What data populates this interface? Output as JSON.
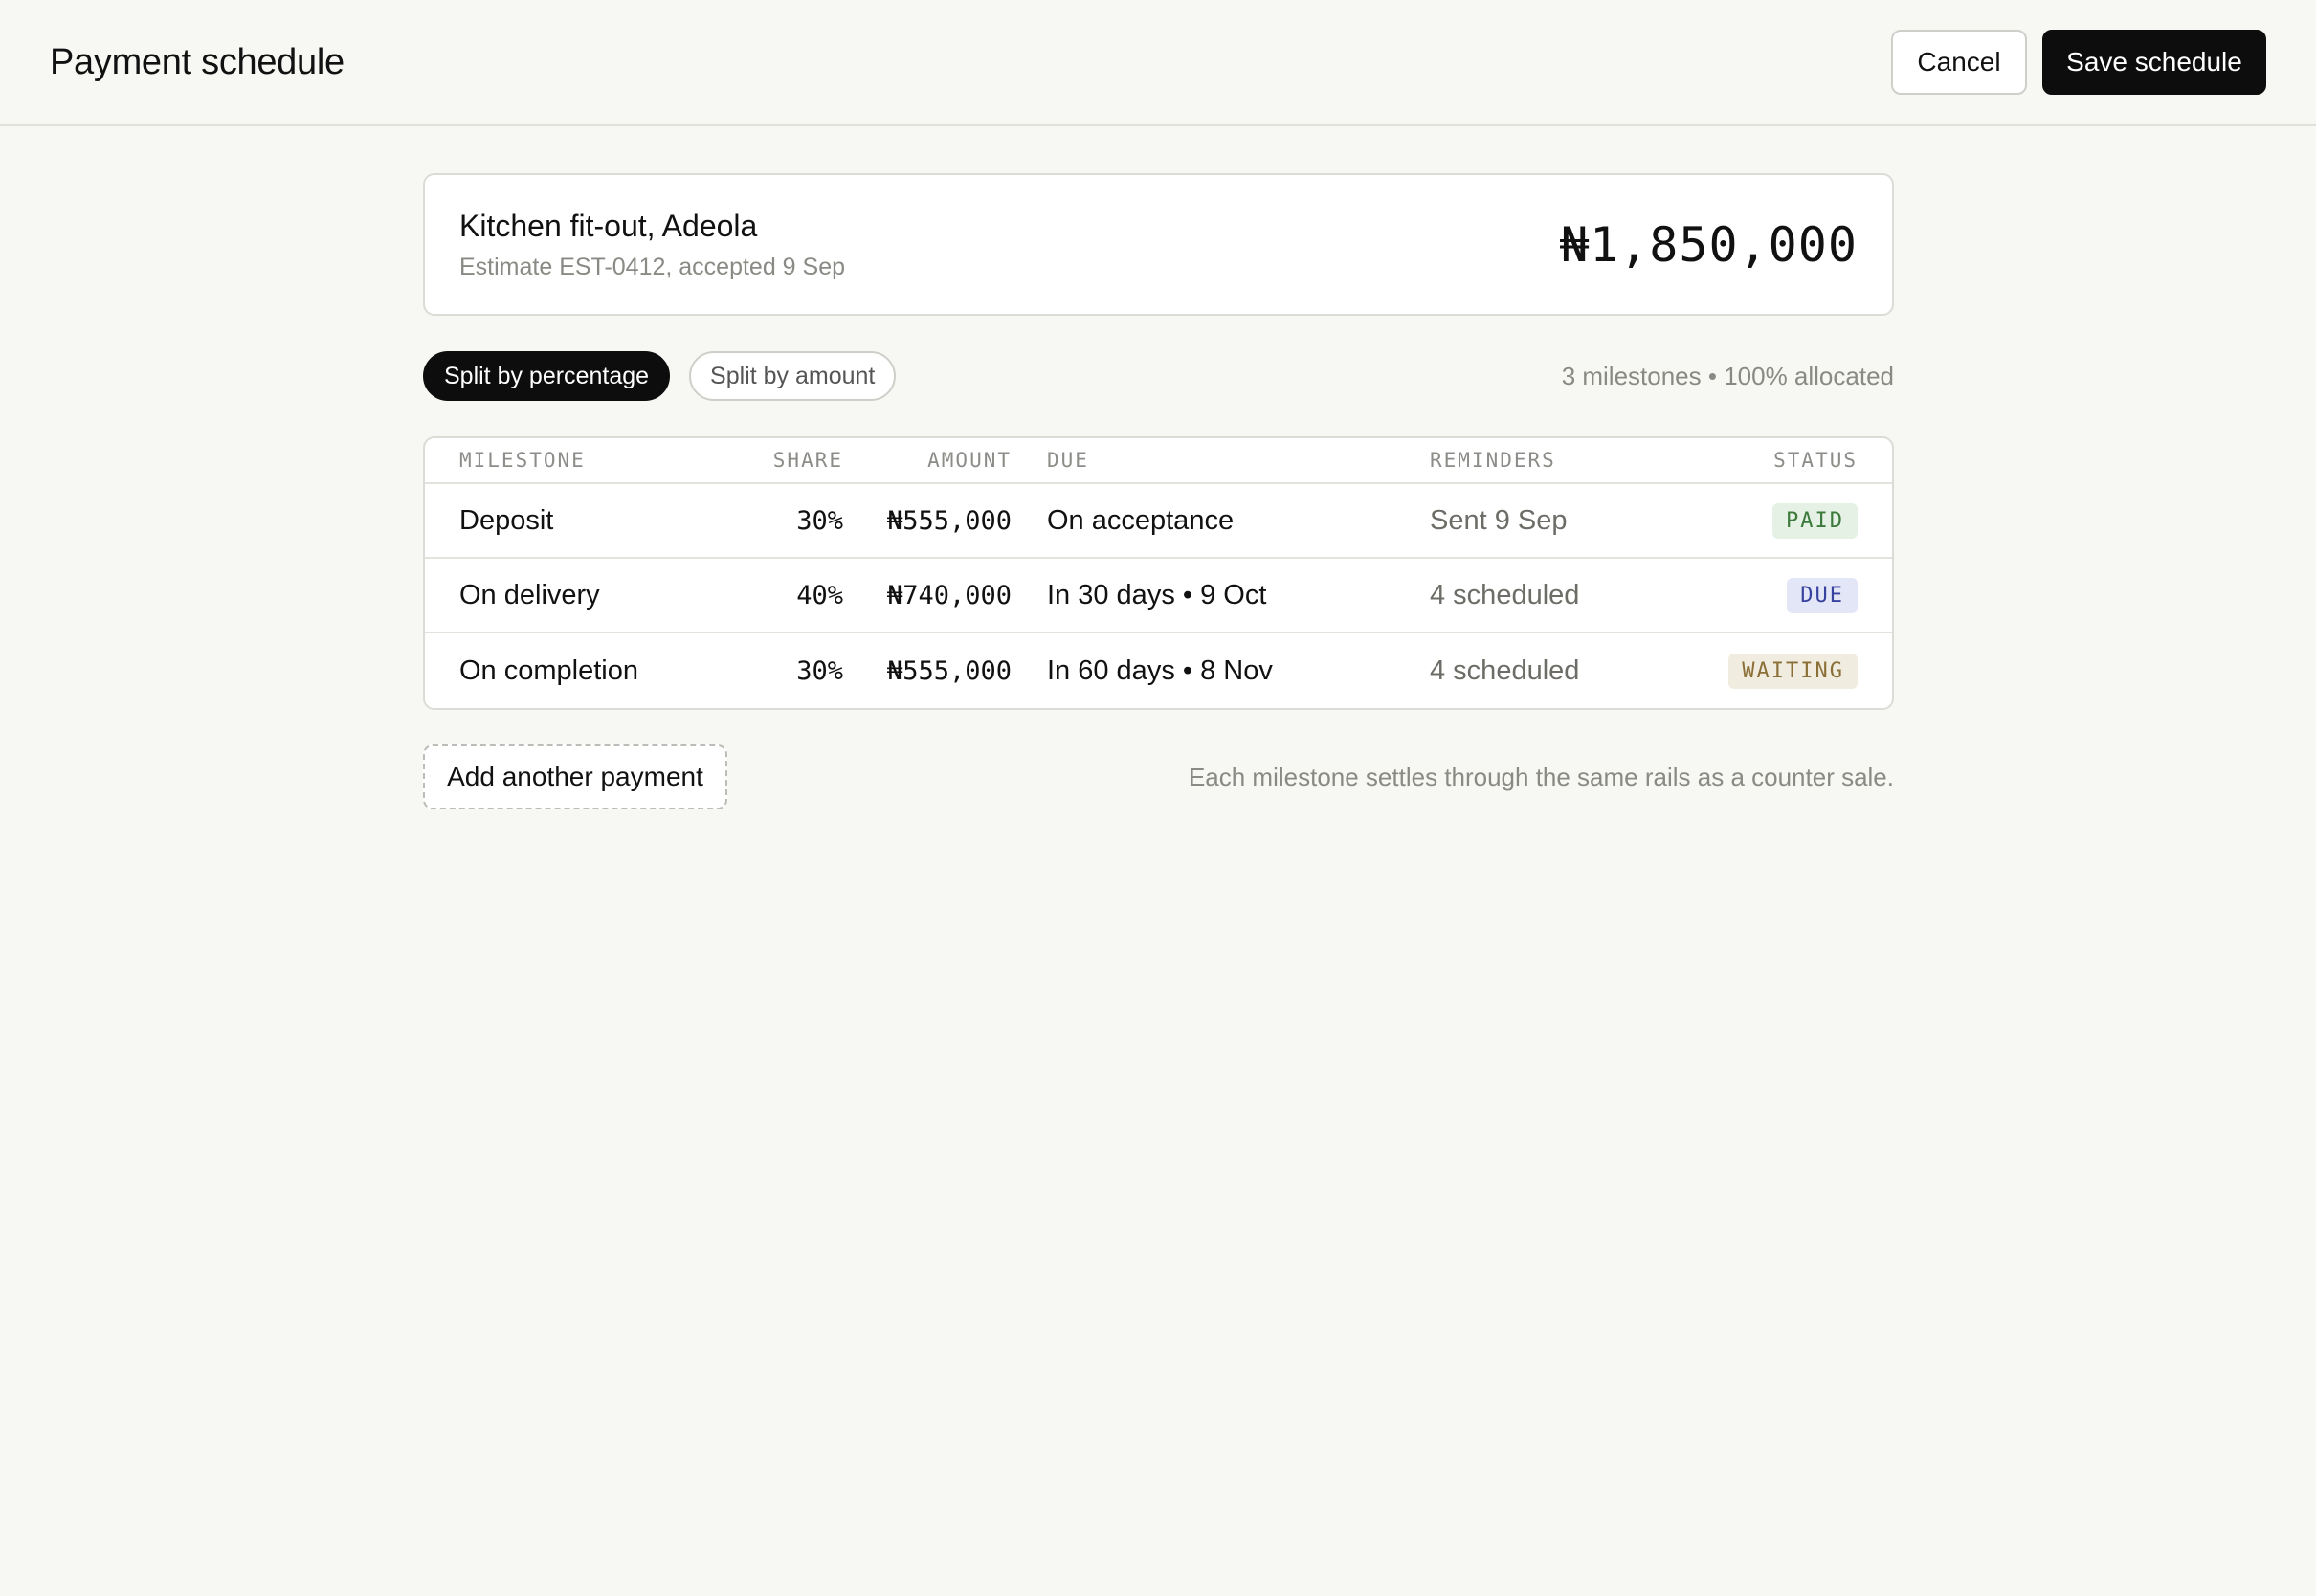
{
  "header": {
    "title": "Payment schedule",
    "cancel_label": "Cancel",
    "save_label": "Save schedule"
  },
  "summary": {
    "name": "Kitchen fit-out, Adeola",
    "subtitle": "Estimate EST-0412, accepted 9 Sep",
    "total": "₦1,850,000"
  },
  "split_toggle": {
    "options": [
      {
        "label": "Split by percentage",
        "active": true
      },
      {
        "label": "Split by amount",
        "active": false
      }
    ]
  },
  "allocation_text": "3 milestones • 100% allocated",
  "table": {
    "columns": [
      "MILESTONE",
      "SHARE",
      "AMOUNT",
      "DUE",
      "REMINDERS",
      "STATUS"
    ],
    "rows": [
      {
        "milestone": "Deposit",
        "share": "30%",
        "amount": "₦555,000",
        "due": "On acceptance",
        "reminders": "Sent 9 Sep",
        "status": "PAID",
        "status_key": "paid"
      },
      {
        "milestone": "On delivery",
        "share": "40%",
        "amount": "₦740,000",
        "due": "In 30 days • 9 Oct",
        "reminders": "4 scheduled",
        "status": "DUE",
        "status_key": "due"
      },
      {
        "milestone": "On completion",
        "share": "30%",
        "amount": "₦555,000",
        "due": "In 60 days • 8 Nov",
        "reminders": "4 scheduled",
        "status": "WAITING",
        "status_key": "waiting"
      }
    ]
  },
  "status_colors": {
    "paid": {
      "bg": "#e4f1e4",
      "fg": "#3b7a3b"
    },
    "due": {
      "bg": "#e2e6f6",
      "fg": "#3843a0"
    },
    "waiting": {
      "bg": "#f1ece0",
      "fg": "#8a6f36"
    }
  },
  "add_payment_label": "Add another payment",
  "footnote": "Each milestone settles through the same rails as a counter sale."
}
